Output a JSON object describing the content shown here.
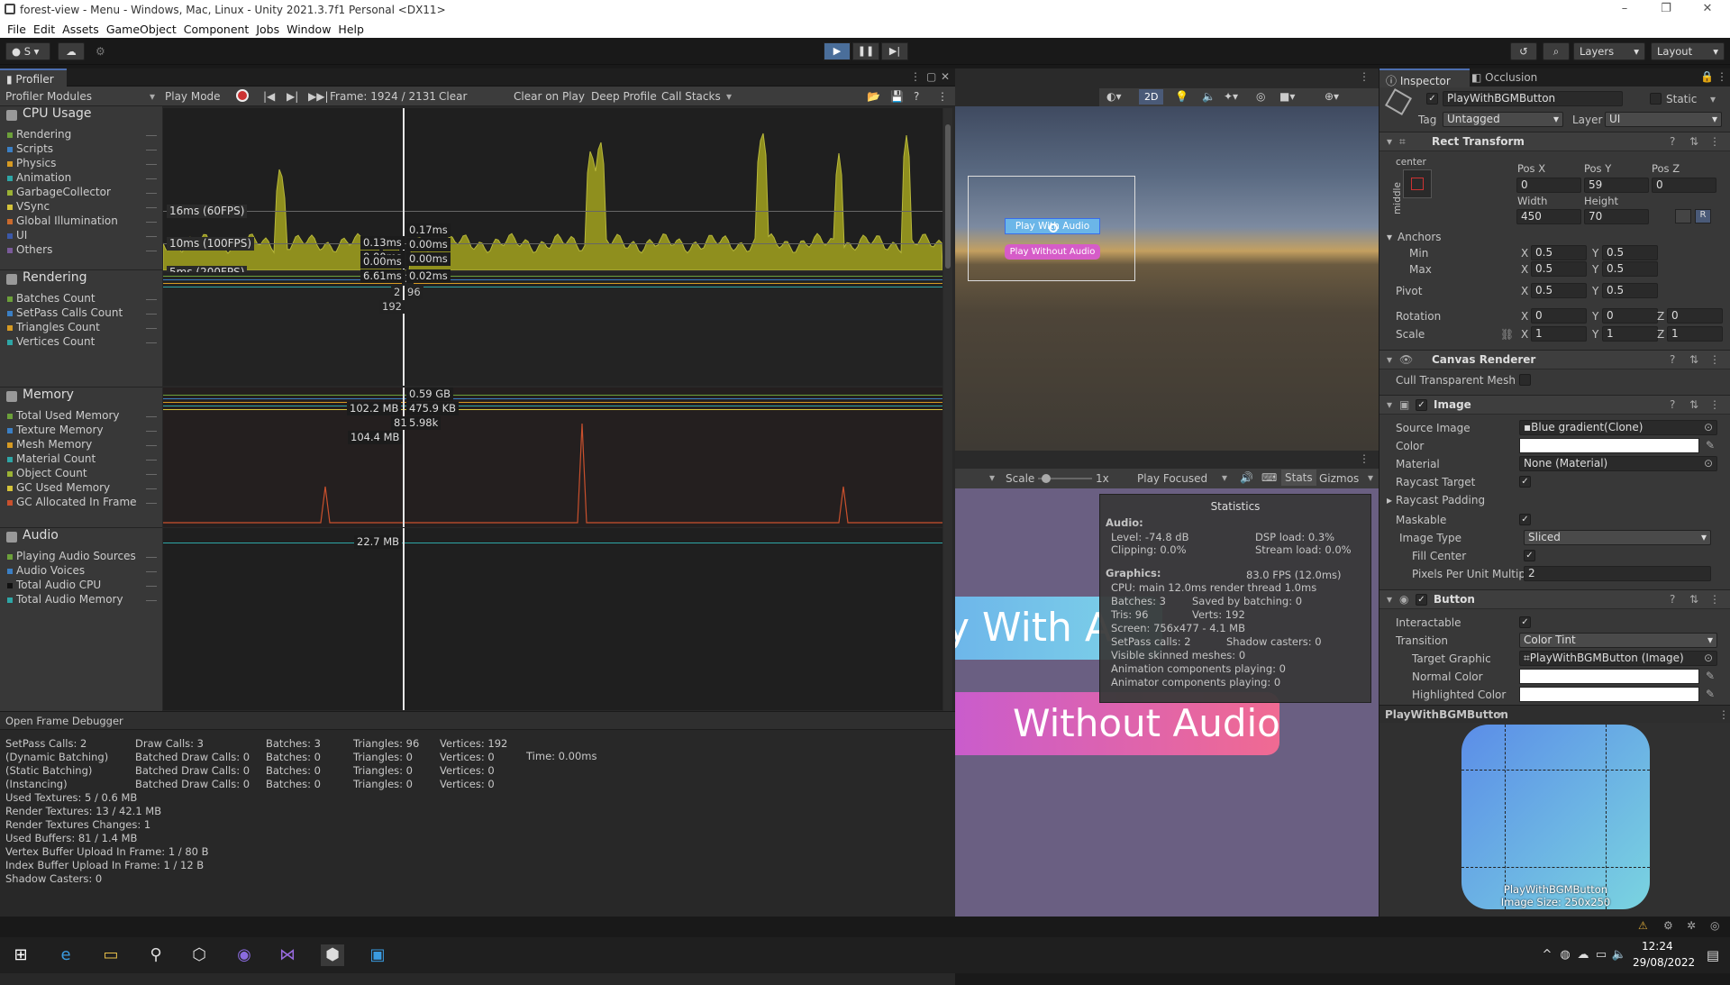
{
  "window": {
    "title": "forest-view - Menu - Windows, Mac, Linux - Unity 2021.3.7f1 Personal <DX11>"
  },
  "menu": [
    "File",
    "Edit",
    "Assets",
    "GameObject",
    "Component",
    "Jobs",
    "Window",
    "Help"
  ],
  "toolbar": {
    "account": "S",
    "layers": "Layers",
    "layout": "Layout"
  },
  "profiler": {
    "tab": "Profiler",
    "modules_label": "Profiler Modules",
    "play_mode": "Play Mode",
    "frame": "Frame: 1924 / 2131",
    "clear": "Clear",
    "clear_on_play": "Clear on Play",
    "deep_profile": "Deep Profile",
    "call_stacks": "Call Stacks",
    "cpu": {
      "title": "CPU Usage",
      "items": [
        {
          "label": "Rendering",
          "color": "#6ca03a"
        },
        {
          "label": "Scripts",
          "color": "#3b7fc4"
        },
        {
          "label": "Physics",
          "color": "#d69a23"
        },
        {
          "label": "Animation",
          "color": "#2ea6a6"
        },
        {
          "label": "GarbageCollector",
          "color": "#9bb234"
        },
        {
          "label": "VSync",
          "color": "#d4c33a"
        },
        {
          "label": "Global Illumination",
          "color": "#c96a2d"
        },
        {
          "label": "UI",
          "color": "#3b58a8"
        },
        {
          "label": "Others",
          "color": "#7a5a9a"
        }
      ],
      "guides": [
        "16ms (60FPS)",
        "10ms (100FPS)",
        "5ms (200FPS)"
      ],
      "values_left": [
        "0.13ms",
        "0.00ms",
        "0.00ms",
        "6.61ms"
      ],
      "values_right": [
        "0.17ms",
        "0.00ms",
        "0.00ms",
        "0.02ms"
      ]
    },
    "rendering": {
      "title": "Rendering",
      "items": [
        {
          "label": "Batches Count",
          "color": "#6ca03a"
        },
        {
          "label": "SetPass Calls Count",
          "color": "#3b7fc4"
        },
        {
          "label": "Triangles Count",
          "color": "#d69a23"
        },
        {
          "label": "Vertices Count",
          "color": "#2ea6a6"
        }
      ],
      "values": [
        "3",
        "2",
        "96",
        "192"
      ]
    },
    "memory": {
      "title": "Memory",
      "items": [
        {
          "label": "Total Used Memory",
          "color": "#6ca03a"
        },
        {
          "label": "Texture Memory",
          "color": "#3b7fc4"
        },
        {
          "label": "Mesh Memory",
          "color": "#d69a23"
        },
        {
          "label": "Material Count",
          "color": "#2ea6a6"
        },
        {
          "label": "Object Count",
          "color": "#9bb234"
        },
        {
          "label": "GC Used Memory",
          "color": "#d4c33a"
        },
        {
          "label": "GC Allocated In Frame",
          "color": "#c9502d"
        }
      ],
      "values": [
        "0.59 GB",
        "102.2 MB",
        "475.9 KB",
        "81",
        "5.98k",
        "104.4 MB"
      ]
    },
    "audio": {
      "title": "Audio",
      "items": [
        {
          "label": "Playing Audio Sources",
          "color": "#6ca03a"
        },
        {
          "label": "Audio Voices",
          "color": "#3b7fc4"
        },
        {
          "label": "Total Audio CPU",
          "color": "#111111"
        },
        {
          "label": "Total Audio Memory",
          "color": "#2ea6a6"
        }
      ],
      "values": [
        "22.7 MB"
      ]
    },
    "frame_debugger": "Open Frame Debugger",
    "stats": {
      "col1": [
        "SetPass Calls: 2",
        "(Dynamic Batching)",
        "(Static Batching)",
        "(Instancing)",
        "Used Textures: 5 / 0.6 MB",
        "Render Textures: 13 / 42.1 MB",
        "Render Textures Changes: 1",
        "Used Buffers: 81 / 1.4 MB",
        "Vertex Buffer Upload In Frame: 1 / 80 B",
        "Index Buffer Upload In Frame: 1 / 12 B",
        "Shadow Casters: 0"
      ],
      "col2": [
        "Draw Calls: 3",
        "Batched Draw Calls: 0",
        "Batched Draw Calls: 0",
        "Batched Draw Calls: 0"
      ],
      "col3": [
        "Batches: 3",
        "Batches: 0",
        "Batches: 0",
        "Batches: 0"
      ],
      "col4": [
        "Triangles: 96",
        "Triangles: 0",
        "Triangles: 0",
        "Triangles: 0"
      ],
      "col5": [
        "Vertices: 192",
        "Vertices: 0",
        "Vertices: 0",
        "Vertices: 0"
      ],
      "time": "Time: 0.00ms"
    }
  },
  "scene": {
    "mode": "2D",
    "btn_with_audio": "Play With Audio",
    "btn_without_audio": "Play Without Audio"
  },
  "game": {
    "scale_label": "Scale",
    "scale_value": "1x",
    "play_focused": "Play Focused",
    "stats_btn": "Stats",
    "gizmos": "Gizmos",
    "big_with": "y With A",
    "big_without": "Without Audio",
    "statistics": {
      "title": "Statistics",
      "audio_hdr": "Audio:",
      "level": "Level: -74.8 dB",
      "clipping": "Clipping: 0.0%",
      "dsp": "DSP load: 0.3%",
      "stream": "Stream load: 0.0%",
      "graphics_hdr": "Graphics:",
      "fps": "83.0 FPS (12.0ms)",
      "cpu": "CPU: main 12.0ms  render thread 1.0ms",
      "batches": "Batches: 3",
      "saved": "Saved by batching: 0",
      "tris": "Tris: 96",
      "verts": "Verts: 192",
      "screen": "Screen: 756x477 - 4.1 MB",
      "setpass": "SetPass calls: 2",
      "shadow": "Shadow casters: 0",
      "skinned": "Visible skinned meshes: 0",
      "anim": "Animation components playing: 0",
      "animator": "Animator components playing: 0"
    }
  },
  "inspector": {
    "tab_inspector": "Inspector",
    "tab_occlusion": "Occlusion",
    "object_name": "PlayWithBGMButton",
    "static_label": "Static",
    "tag_label": "Tag",
    "tag_value": "Untagged",
    "layer_label": "Layer",
    "layer_value": "UI",
    "rect": {
      "title": "Rect Transform",
      "anchor_h": "center",
      "anchor_v": "middle",
      "posx_label": "Pos X",
      "posy_label": "Pos Y",
      "posz_label": "Pos Z",
      "posx": "0",
      "posy": "59",
      "posz": "0",
      "width_label": "Width",
      "height_label": "Height",
      "width": "450",
      "height": "70",
      "anchors": "Anchors",
      "min": "Min",
      "max": "Max",
      "pivot": "Pivot",
      "min_x": "0.5",
      "min_y": "0.5",
      "max_x": "0.5",
      "max_y": "0.5",
      "pivot_x": "0.5",
      "pivot_y": "0.5",
      "rotation": "Rotation",
      "rot_x": "0",
      "rot_y": "0",
      "rot_z": "0",
      "scale": "Scale",
      "sc_x": "1",
      "sc_y": "1",
      "sc_z": "1"
    },
    "canvas_renderer": {
      "title": "Canvas Renderer",
      "cull": "Cull Transparent Mesh"
    },
    "image": {
      "title": "Image",
      "source_label": "Source Image",
      "source_value": "Blue gradient(Clone)",
      "color_label": "Color",
      "material_label": "Material",
      "material_value": "None (Material)",
      "raycast_target": "Raycast Target",
      "raycast_padding": "Raycast Padding",
      "maskable": "Maskable",
      "image_type_label": "Image Type",
      "image_type": "Sliced",
      "fill_center": "Fill Center",
      "ppu_label": "Pixels Per Unit Multip",
      "ppu": "2"
    },
    "button": {
      "title": "Button",
      "interactable": "Interactable",
      "transition_label": "Transition",
      "transition": "Color Tint",
      "target_label": "Target Graphic",
      "target_value": "PlayWithBGMButton (Image)",
      "normal": "Normal Color",
      "highlighted": "Highlighted Color"
    },
    "preview": {
      "title": "PlayWithBGMButton",
      "caption1": "PlayWithBGMButton",
      "caption2": "Image Size: 250x250"
    }
  },
  "taskbar": {
    "time": "12:24",
    "date": "29/08/2022"
  }
}
